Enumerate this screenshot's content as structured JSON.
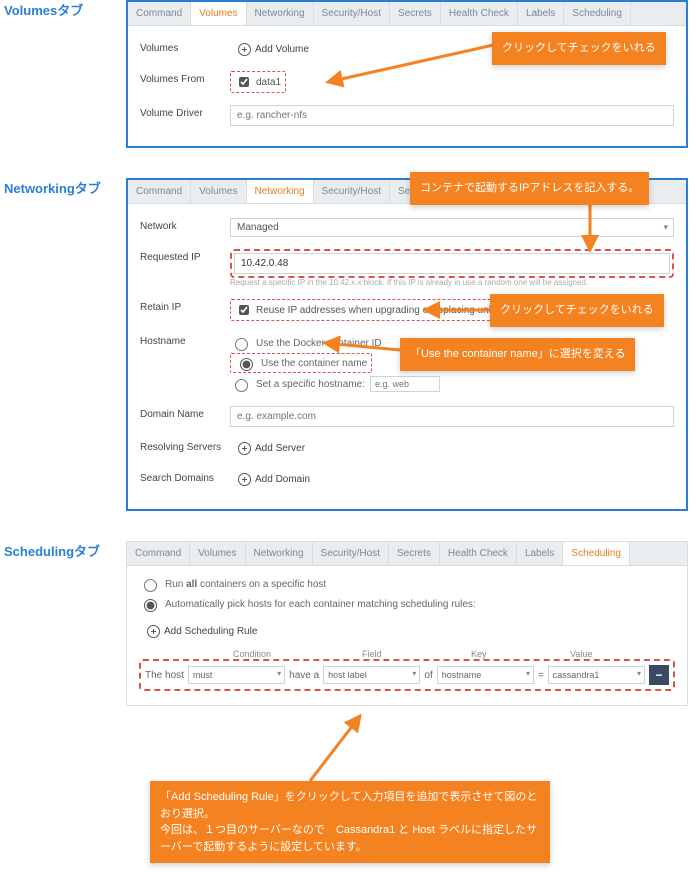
{
  "common_tabs": [
    "Command",
    "Volumes",
    "Networking",
    "Security/Host",
    "Secrets",
    "Health Check",
    "Labels",
    "Scheduling"
  ],
  "sections": {
    "volumes": {
      "title": "Volumesタブ",
      "active_tab": "Volumes",
      "rows": {
        "volumes_label": "Volumes",
        "add_volume": "Add Volume",
        "volumes_from_label": "Volumes From",
        "data1_label": "data1",
        "volume_driver_label": "Volume Driver",
        "volume_driver_placeholder": "e.g. rancher-nfs"
      },
      "callout": "クリックしてチェックをいれる"
    },
    "networking": {
      "title": "Networkingタブ",
      "active_tab": "Networking",
      "rows": {
        "network_label": "Network",
        "network_value": "Managed",
        "requested_ip_label": "Requested IP",
        "requested_ip_value": "10.42.0.48",
        "requested_ip_hint": "Request a specific IP in the 10.42.x.x block. If this IP is already in use a random one will be assigned.",
        "retain_ip_label": "Retain IP",
        "retain_ip_check": "Reuse IP addresses when upgrading or replacing unhealthy instances.",
        "hostname_label": "Hostname",
        "hostname_opts": {
          "a": "Use the Docker container ID",
          "b": "Use the container name",
          "c": "Set a specific hostname:"
        },
        "hostname_placeholder": "e.g. web",
        "domain_label": "Domain Name",
        "domain_placeholder": "e.g. example.com",
        "resolving_label": "Resolving Servers",
        "add_server": "Add Server",
        "search_domains_label": "Search Domains",
        "add_domain": "Add Domain"
      },
      "callouts": {
        "ip": "コンテナで起動するIPアドレスを記入する。",
        "retain": "クリックしてチェックをいれる",
        "hostname": "「Use the container name」に選択を変える"
      }
    },
    "scheduling": {
      "title": "Schedulingタブ",
      "active_tab": "Scheduling",
      "radios": {
        "a": "Run all containers on a specific host",
        "b": "Automatically pick hosts for each container matching scheduling rules:"
      },
      "add_rule": "Add Scheduling Rule",
      "headers": {
        "cond": "Condition",
        "field": "Field",
        "key": "Key",
        "val": "Value"
      },
      "rule": {
        "prefix": "The host",
        "cond": "must",
        "mid": "have a",
        "field": "host label",
        "of": "of",
        "key": "hostname",
        "eq": "=",
        "val": "cassandra1"
      },
      "callout": "「Add Scheduling Rule」をクリックして入力項目を追加で表示させて図のとおり選択。\n今回は、１つ目のサーバーなので　Cassandra1 と Host ラベルに指定したサーバーで起動するように設定しています。"
    }
  }
}
